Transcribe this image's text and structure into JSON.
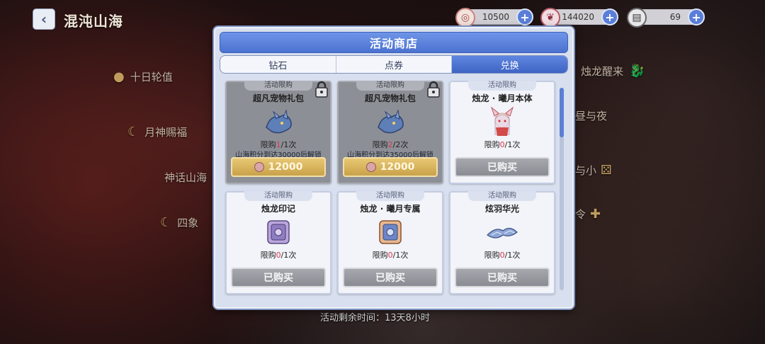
{
  "page": {
    "title": "混沌山海",
    "back_icon": "back-arrow-icon",
    "remaining_time": "活动剩余时间：13天8小时"
  },
  "currencies": [
    {
      "icon": "coin-icon",
      "value": "10500",
      "color": "#c9837f"
    },
    {
      "icon": "feather-icon",
      "value": "144020",
      "color": "#b45b66"
    },
    {
      "icon": "ticket-icon",
      "value": "69",
      "color": "#555"
    }
  ],
  "side_menu": [
    {
      "label": "十日轮值"
    },
    {
      "label": "月神赐福"
    },
    {
      "label": "神话山海"
    },
    {
      "label": "四象"
    },
    {
      "label": "烛龙醒来"
    },
    {
      "label": "昼与夜"
    },
    {
      "label": "与小"
    },
    {
      "label": "令"
    }
  ],
  "modal": {
    "title": "活动商店",
    "tabs": [
      {
        "label": "钻石",
        "active": false
      },
      {
        "label": "点券",
        "active": false
      },
      {
        "label": "兑换",
        "active": true
      }
    ],
    "scroll_position": 0.0,
    "items": [
      {
        "tag": "活动限购",
        "name": "超凡宠物礼包",
        "limit_prefix": "限购",
        "limit_count": "1",
        "limit_suffix": "/1次",
        "condition": "山海积分到达30000后解锁",
        "locked": true,
        "button": "12000",
        "state": "price",
        "art": "dragon-pet-icon"
      },
      {
        "tag": "活动限购",
        "name": "超凡宠物礼包",
        "limit_prefix": "限购",
        "limit_count": "2",
        "limit_suffix": "/2次",
        "condition": "山海积分到达35000后解锁",
        "locked": true,
        "button": "12000",
        "state": "price",
        "art": "dragon-pet-icon"
      },
      {
        "tag": "活动限购",
        "name": "烛龙 · 曦月本体",
        "limit_prefix": "限购",
        "limit_count": "0",
        "limit_suffix": "/1次",
        "condition": "",
        "locked": false,
        "button": "已购买",
        "state": "bought",
        "art": "character-portrait-icon"
      },
      {
        "tag": "活动限购",
        "name": "烛龙印记",
        "limit_prefix": "限购",
        "limit_count": "0",
        "limit_suffix": "/1次",
        "condition": "",
        "locked": false,
        "button": "已购买",
        "state": "bought",
        "art": "mark-box-icon"
      },
      {
        "tag": "活动限购",
        "name": "烛龙 · 曦月专属",
        "limit_prefix": "限购",
        "limit_count": "0",
        "limit_suffix": "/1次",
        "condition": "",
        "locked": false,
        "button": "已购买",
        "state": "bought",
        "art": "exclusive-box-icon"
      },
      {
        "tag": "活动限购",
        "name": "炫羽华光",
        "limit_prefix": "限购",
        "limit_count": "0",
        "limit_suffix": "/1次",
        "condition": "",
        "locked": false,
        "button": "已购买",
        "state": "bought",
        "art": "wing-effect-icon"
      }
    ]
  }
}
